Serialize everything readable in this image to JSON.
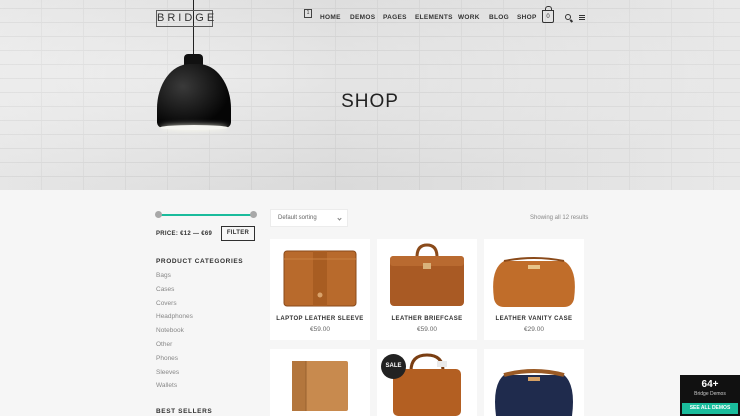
{
  "header": {
    "logo": "BRIDGE",
    "badge": "1",
    "nav": [
      "HOME",
      "DEMOS",
      "PAGES",
      "ELEMENTS",
      "WORK",
      "BLOG",
      "SHOP"
    ],
    "cart_count": "0"
  },
  "hero": {
    "title": "SHOP"
  },
  "sidebar": {
    "price_range": {
      "min_fraction": 0.0,
      "max_fraction": 1.0
    },
    "price_label": "PRICE: €12 — €69",
    "filter_label": "FILTER",
    "categories_title": "PRODUCT CATEGORIES",
    "categories": [
      "Bags",
      "Cases",
      "Covers",
      "Headphones",
      "Notebook",
      "Other",
      "Phones",
      "Sleeves",
      "Wallets"
    ],
    "best_sellers_title": "BEST SELLERS"
  },
  "main": {
    "sort_label": "Default sorting",
    "result_count": "Showing all 12 results",
    "products": [
      {
        "name": "LAPTOP LEATHER SLEEVE",
        "price": "€59.00"
      },
      {
        "name": "LEATHER BRIEFCASE",
        "price": "€59.00"
      },
      {
        "name": "LEATHER VANITY CASE",
        "price": "€29.00"
      },
      {
        "name": "",
        "price": ""
      },
      {
        "name": "",
        "price": "",
        "badge": "SALE"
      },
      {
        "name": "",
        "price": ""
      }
    ]
  },
  "demos_widget": {
    "count": "64+",
    "label": "Bridge Demos",
    "button": "SEE ALL DEMOS"
  },
  "colors": {
    "accent": "#1abc9c",
    "leather": "#b8692e",
    "navy": "#1f2b4d"
  }
}
